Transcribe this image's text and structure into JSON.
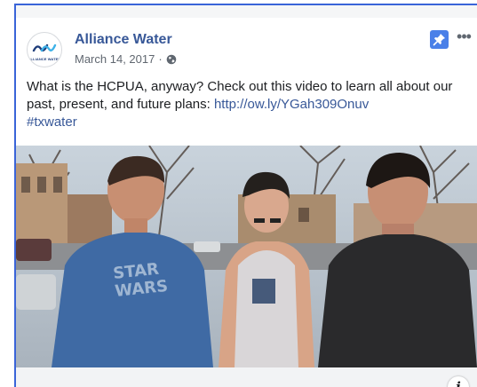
{
  "post": {
    "page_name": "Alliance Water",
    "avatar_text": "ALLIANCE WATER",
    "date": "March 14, 2017",
    "separator": "·",
    "privacy_icon": "globe-icon",
    "pin_icon": "pin-icon",
    "more_label": "•••",
    "text_before_link": "What is the HCPUA, anyway? Check out this video to learn all about our past, present, and future plans: ",
    "link": "http://ow.ly/YGah309Onuv",
    "hashtag": "#txwater",
    "info_label": "i"
  },
  "colors": {
    "brand_link": "#385898",
    "pin_button": "#4a80e8",
    "meta_text": "#606770",
    "frame_border": "#3a64d8"
  }
}
